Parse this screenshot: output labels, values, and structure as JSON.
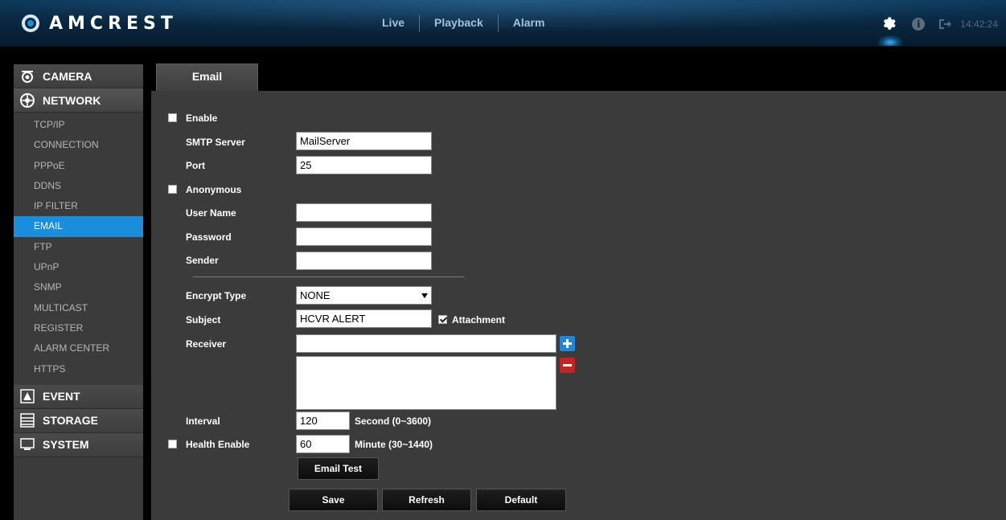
{
  "brand": {
    "name": "AMCREST"
  },
  "nav": {
    "live": "Live",
    "playback": "Playback",
    "alarm": "Alarm"
  },
  "header": {
    "time": "14:42:24",
    "icons": [
      "gear-icon",
      "info-icon",
      "logout-icon"
    ]
  },
  "sidebar": {
    "camera": "CAMERA",
    "network": "NETWORK",
    "network_items": [
      "TCP/IP",
      "CONNECTION",
      "PPPoE",
      "DDNS",
      "IP FILTER",
      "EMAIL",
      "FTP",
      "UPnP",
      "SNMP",
      "MULTICAST",
      "REGISTER",
      "ALARM CENTER",
      "HTTPS"
    ],
    "active_item": "EMAIL",
    "event": "EVENT",
    "storage": "STORAGE",
    "system": "SYSTEM"
  },
  "tab": {
    "label": "Email"
  },
  "form": {
    "enable_label": "Enable",
    "enable_checked": false,
    "smtp_label": "SMTP Server",
    "smtp_value": "MailServer",
    "port_label": "Port",
    "port_value": "25",
    "anonymous_label": "Anonymous",
    "anonymous_checked": false,
    "username_label": "User Name",
    "username_value": "",
    "password_label": "Password",
    "password_value": "",
    "sender_label": "Sender",
    "sender_value": "",
    "encrypt_label": "Encrypt Type",
    "encrypt_value": "NONE",
    "subject_label": "Subject",
    "subject_value": "HCVR ALERT",
    "attachment_label": "Attachment",
    "attachment_checked": true,
    "receiver_label": "Receiver",
    "receiver_value": "",
    "interval_label": "Interval",
    "interval_value": "120",
    "interval_unit": "Second (0~3600)",
    "health_label": "Health Enable",
    "health_checked": false,
    "health_value": "60",
    "health_unit": "Minute (30~1440)",
    "email_test": "Email Test",
    "save": "Save",
    "refresh": "Refresh",
    "default": "Default"
  },
  "colors": {
    "accent": "#1a8ddc",
    "remove": "#c42424",
    "panel": "#3b3b3b"
  }
}
